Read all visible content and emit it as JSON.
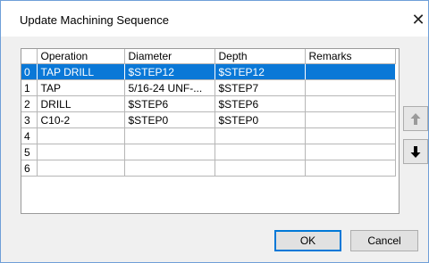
{
  "window": {
    "title": "Update Machining Sequence",
    "close_glyph": "✕"
  },
  "grid": {
    "columns": [
      "",
      "Operation",
      "Diameter",
      "Depth",
      "Remarks"
    ],
    "rows": [
      {
        "index": "0",
        "operation": "TAP DRILL",
        "diameter": "$STEP12",
        "depth": "$STEP12",
        "remarks": ""
      },
      {
        "index": "1",
        "operation": "TAP",
        "diameter": "5/16-24 UNF-...",
        "depth": "$STEP7",
        "remarks": ""
      },
      {
        "index": "2",
        "operation": "DRILL",
        "diameter": "$STEP6",
        "depth": "$STEP6",
        "remarks": ""
      },
      {
        "index": "3",
        "operation": "C10-2",
        "diameter": "$STEP0",
        "depth": "$STEP0",
        "remarks": ""
      },
      {
        "index": "4",
        "operation": "",
        "diameter": "",
        "depth": "",
        "remarks": ""
      },
      {
        "index": "5",
        "operation": "",
        "diameter": "",
        "depth": "",
        "remarks": ""
      },
      {
        "index": "6",
        "operation": "",
        "diameter": "",
        "depth": "",
        "remarks": ""
      }
    ],
    "selected_row": 0
  },
  "side_buttons": {
    "up_icon": "arrow-up-icon",
    "down_icon": "arrow-down-icon"
  },
  "buttons": {
    "ok": "OK",
    "cancel": "Cancel"
  },
  "colors": {
    "selection": "#0a78d7",
    "up_arrow_disabled": "#9a9a9a",
    "down_arrow": "#000000"
  }
}
